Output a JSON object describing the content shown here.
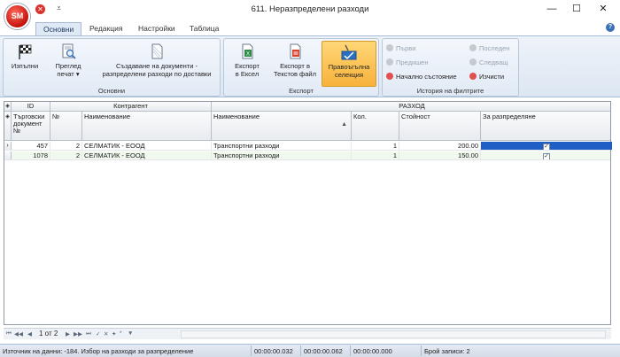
{
  "window": {
    "title": "611. Неразпределени разходи",
    "logo": "SM",
    "minimize": "—",
    "maximize": "☐",
    "close": "✕"
  },
  "tabs": [
    {
      "label": "Основни",
      "active": true
    },
    {
      "label": "Редакция",
      "active": false
    },
    {
      "label": "Настройки",
      "active": false
    },
    {
      "label": "Таблица",
      "active": false
    }
  ],
  "ribbon": {
    "groups": {
      "main": "Основни",
      "export": "Експорт",
      "filters": "История на филтрите"
    },
    "buttons": {
      "exit": "Изпълни",
      "preview_line1": "Преглед",
      "preview_line2": "печат ▾",
      "create_docs_line1": "Създаване на документи -",
      "create_docs_line2": "разпределени разходи по доставки",
      "export_excel_line1": "Експорт",
      "export_excel_line2": "в Ексел",
      "export_text_line1": "Експорт в",
      "export_text_line2": "Текстов файл",
      "rect_sel_line1": "Правоъгълна",
      "rect_sel_line2": "селекция"
    },
    "filters": {
      "first": "Първи",
      "last": "Последен",
      "prev": "Предишен",
      "next": "Следващ",
      "initial": "Начално състояние",
      "clear": "Изчисти"
    }
  },
  "grid": {
    "bands": {
      "id": "ID",
      "contractor": "Контрагент",
      "expense": "РАЗХОД"
    },
    "columns": {
      "doc": "Търговски документ №",
      "no": "№",
      "name1": "Наименование",
      "name2": "Наименование",
      "qty": "Кол.",
      "value": "Стойност",
      "distribute": "За разпределяне"
    },
    "rows": [
      {
        "doc": "457",
        "no": "2",
        "contractor": "СЕЛМАТИК - ЕООД",
        "expense": "Транспортни разходи",
        "qty": "1",
        "value": "200.00",
        "distribute": true
      },
      {
        "doc": "1078",
        "no": "2",
        "contractor": "СЕЛМАТИК - ЕООД",
        "expense": "Транспортни разходи",
        "qty": "1",
        "value": "150.00",
        "distribute": true
      }
    ]
  },
  "navigator": {
    "position": "1 от 2"
  },
  "status": {
    "source": "Източник на данни: -184. Избор на разходи за разпределение",
    "t1": "00:00:00.032",
    "t2": "00:00:00.062",
    "t3": "00:00:00.000",
    "records": "Брой записи: 2"
  }
}
